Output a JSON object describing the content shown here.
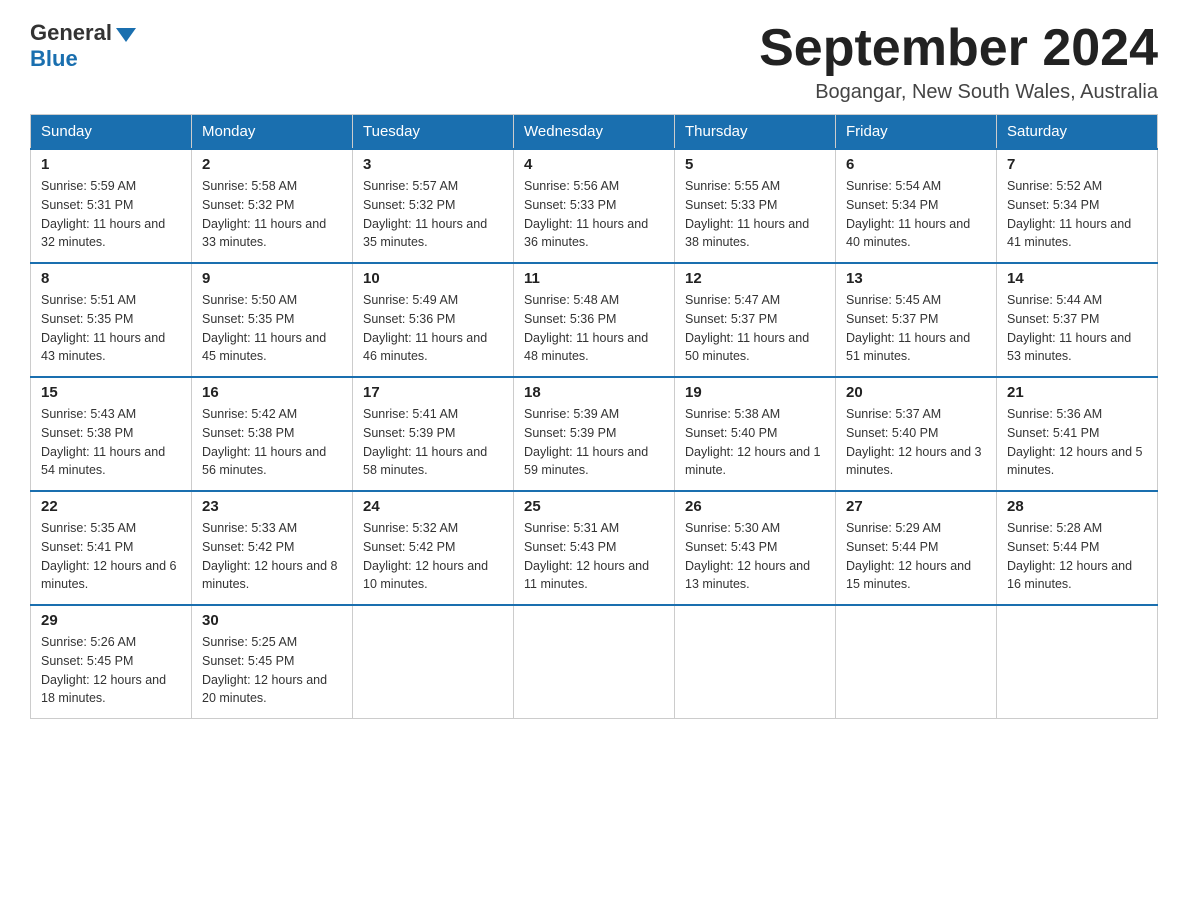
{
  "header": {
    "logo_general": "General",
    "logo_blue": "Blue",
    "month_title": "September 2024",
    "location": "Bogangar, New South Wales, Australia"
  },
  "days_of_week": [
    "Sunday",
    "Monday",
    "Tuesday",
    "Wednesday",
    "Thursday",
    "Friday",
    "Saturday"
  ],
  "weeks": [
    [
      {
        "day": "1",
        "sunrise": "5:59 AM",
        "sunset": "5:31 PM",
        "daylight": "11 hours and 32 minutes."
      },
      {
        "day": "2",
        "sunrise": "5:58 AM",
        "sunset": "5:32 PM",
        "daylight": "11 hours and 33 minutes."
      },
      {
        "day": "3",
        "sunrise": "5:57 AM",
        "sunset": "5:32 PM",
        "daylight": "11 hours and 35 minutes."
      },
      {
        "day": "4",
        "sunrise": "5:56 AM",
        "sunset": "5:33 PM",
        "daylight": "11 hours and 36 minutes."
      },
      {
        "day": "5",
        "sunrise": "5:55 AM",
        "sunset": "5:33 PM",
        "daylight": "11 hours and 38 minutes."
      },
      {
        "day": "6",
        "sunrise": "5:54 AM",
        "sunset": "5:34 PM",
        "daylight": "11 hours and 40 minutes."
      },
      {
        "day": "7",
        "sunrise": "5:52 AM",
        "sunset": "5:34 PM",
        "daylight": "11 hours and 41 minutes."
      }
    ],
    [
      {
        "day": "8",
        "sunrise": "5:51 AM",
        "sunset": "5:35 PM",
        "daylight": "11 hours and 43 minutes."
      },
      {
        "day": "9",
        "sunrise": "5:50 AM",
        "sunset": "5:35 PM",
        "daylight": "11 hours and 45 minutes."
      },
      {
        "day": "10",
        "sunrise": "5:49 AM",
        "sunset": "5:36 PM",
        "daylight": "11 hours and 46 minutes."
      },
      {
        "day": "11",
        "sunrise": "5:48 AM",
        "sunset": "5:36 PM",
        "daylight": "11 hours and 48 minutes."
      },
      {
        "day": "12",
        "sunrise": "5:47 AM",
        "sunset": "5:37 PM",
        "daylight": "11 hours and 50 minutes."
      },
      {
        "day": "13",
        "sunrise": "5:45 AM",
        "sunset": "5:37 PM",
        "daylight": "11 hours and 51 minutes."
      },
      {
        "day": "14",
        "sunrise": "5:44 AM",
        "sunset": "5:37 PM",
        "daylight": "11 hours and 53 minutes."
      }
    ],
    [
      {
        "day": "15",
        "sunrise": "5:43 AM",
        "sunset": "5:38 PM",
        "daylight": "11 hours and 54 minutes."
      },
      {
        "day": "16",
        "sunrise": "5:42 AM",
        "sunset": "5:38 PM",
        "daylight": "11 hours and 56 minutes."
      },
      {
        "day": "17",
        "sunrise": "5:41 AM",
        "sunset": "5:39 PM",
        "daylight": "11 hours and 58 minutes."
      },
      {
        "day": "18",
        "sunrise": "5:39 AM",
        "sunset": "5:39 PM",
        "daylight": "11 hours and 59 minutes."
      },
      {
        "day": "19",
        "sunrise": "5:38 AM",
        "sunset": "5:40 PM",
        "daylight": "12 hours and 1 minute."
      },
      {
        "day": "20",
        "sunrise": "5:37 AM",
        "sunset": "5:40 PM",
        "daylight": "12 hours and 3 minutes."
      },
      {
        "day": "21",
        "sunrise": "5:36 AM",
        "sunset": "5:41 PM",
        "daylight": "12 hours and 5 minutes."
      }
    ],
    [
      {
        "day": "22",
        "sunrise": "5:35 AM",
        "sunset": "5:41 PM",
        "daylight": "12 hours and 6 minutes."
      },
      {
        "day": "23",
        "sunrise": "5:33 AM",
        "sunset": "5:42 PM",
        "daylight": "12 hours and 8 minutes."
      },
      {
        "day": "24",
        "sunrise": "5:32 AM",
        "sunset": "5:42 PM",
        "daylight": "12 hours and 10 minutes."
      },
      {
        "day": "25",
        "sunrise": "5:31 AM",
        "sunset": "5:43 PM",
        "daylight": "12 hours and 11 minutes."
      },
      {
        "day": "26",
        "sunrise": "5:30 AM",
        "sunset": "5:43 PM",
        "daylight": "12 hours and 13 minutes."
      },
      {
        "day": "27",
        "sunrise": "5:29 AM",
        "sunset": "5:44 PM",
        "daylight": "12 hours and 15 minutes."
      },
      {
        "day": "28",
        "sunrise": "5:28 AM",
        "sunset": "5:44 PM",
        "daylight": "12 hours and 16 minutes."
      }
    ],
    [
      {
        "day": "29",
        "sunrise": "5:26 AM",
        "sunset": "5:45 PM",
        "daylight": "12 hours and 18 minutes."
      },
      {
        "day": "30",
        "sunrise": "5:25 AM",
        "sunset": "5:45 PM",
        "daylight": "12 hours and 20 minutes."
      },
      null,
      null,
      null,
      null,
      null
    ]
  ],
  "labels": {
    "sunrise": "Sunrise:",
    "sunset": "Sunset:",
    "daylight": "Daylight:"
  }
}
